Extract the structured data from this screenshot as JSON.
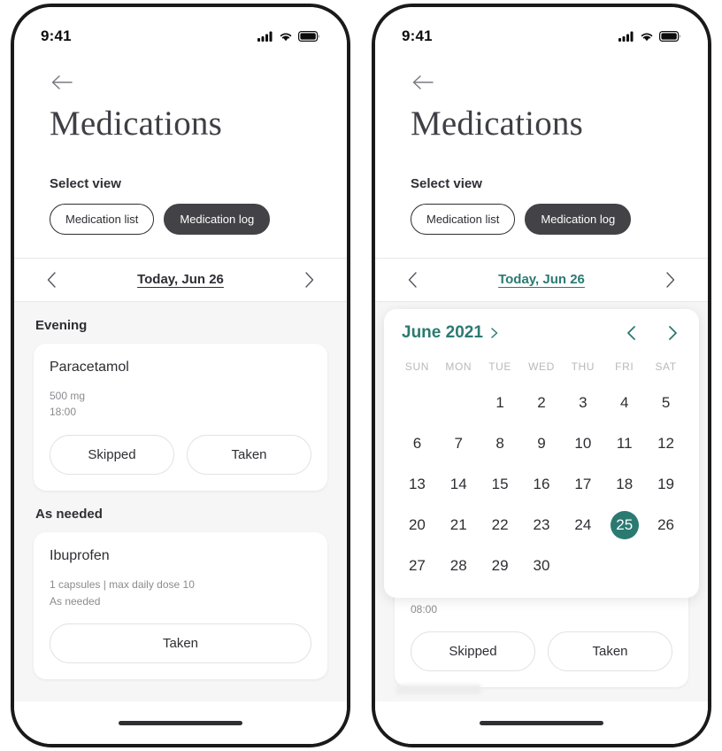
{
  "status_bar": {
    "time": "9:41",
    "icons": [
      "cellular-signal-icon",
      "wifi-icon",
      "battery-icon"
    ]
  },
  "theme": {
    "teal": "#2b7a72",
    "chip_active_bg": "#424247",
    "screen_bg": "#f6f6f7",
    "card_bg": "#ffffff"
  },
  "left_phone": {
    "header": {
      "back": "back-arrow-icon",
      "title": "Medications"
    },
    "select_view": {
      "label": "Select view",
      "chips": [
        {
          "label": "Medication list",
          "active": false
        },
        {
          "label": "Medication log",
          "active": true
        }
      ]
    },
    "date_nav": {
      "prev": "chevron-left-icon",
      "label": "Today, Jun 26",
      "next": "chevron-right-icon",
      "highlight": false
    },
    "sections": [
      {
        "title": "Evening",
        "cards": [
          {
            "name": "Paracetamol",
            "meta": [
              "500 mg",
              "18:00"
            ],
            "buttons": [
              "Skipped",
              "Taken"
            ]
          }
        ]
      },
      {
        "title": "As needed",
        "cards": [
          {
            "name": "Ibuprofen",
            "meta": [
              "1 capsules | max daily dose 10",
              "As needed"
            ],
            "buttons": [
              "Taken"
            ]
          }
        ]
      }
    ]
  },
  "right_phone": {
    "header": {
      "back": "back-arrow-icon",
      "title": "Medications"
    },
    "select_view": {
      "label": "Select view",
      "chips": [
        {
          "label": "Medication list",
          "active": false
        },
        {
          "label": "Medication log",
          "active": true
        }
      ]
    },
    "date_nav": {
      "prev": "chevron-left-icon",
      "label": "Today, Jun 26",
      "next": "chevron-right-icon",
      "highlight": true
    },
    "calendar": {
      "month_label": "June 2021",
      "month_expand_icon": "chevron-right-icon",
      "prev_icon": "chevron-left-icon",
      "next_icon": "chevron-right-icon",
      "day_headers": [
        "SUN",
        "MON",
        "TUE",
        "WED",
        "THU",
        "FRI",
        "SAT"
      ],
      "leading_blanks": 2,
      "days": [
        1,
        2,
        3,
        4,
        5,
        6,
        7,
        8,
        9,
        10,
        11,
        12,
        13,
        14,
        15,
        16,
        17,
        18,
        19,
        20,
        21,
        22,
        23,
        24,
        25,
        26,
        27,
        28,
        29,
        30
      ],
      "selected_day": 25
    },
    "partial_card": {
      "time": "08:00",
      "buttons": [
        "Skipped",
        "Taken"
      ]
    }
  }
}
